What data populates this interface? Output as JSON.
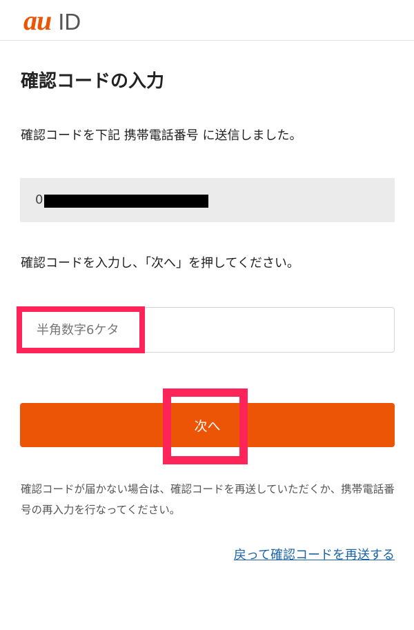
{
  "header": {
    "logo_au": "au",
    "logo_id": "ID"
  },
  "main": {
    "title": "確認コードの入力",
    "sent_message": "確認コードを下記 携帯電話番号 に送信しました。",
    "phone_prefix": "0",
    "instruction": "確認コードを入力し、「次へ」を押してください。",
    "code_input": {
      "placeholder": "半角数字6ケタ",
      "value": ""
    },
    "next_label": "次へ",
    "help_text": "確認コードが届かない場合は、確認コードを再送していただくか、携帯電話番号の再入力を行なってください。",
    "resend_link": "戻って確認コードを再送する"
  },
  "colors": {
    "brand_orange": "#eb5505",
    "highlight_pink": "#fe2459",
    "link_blue": "#1a63a8",
    "phone_box_bg": "#ebebeb"
  }
}
